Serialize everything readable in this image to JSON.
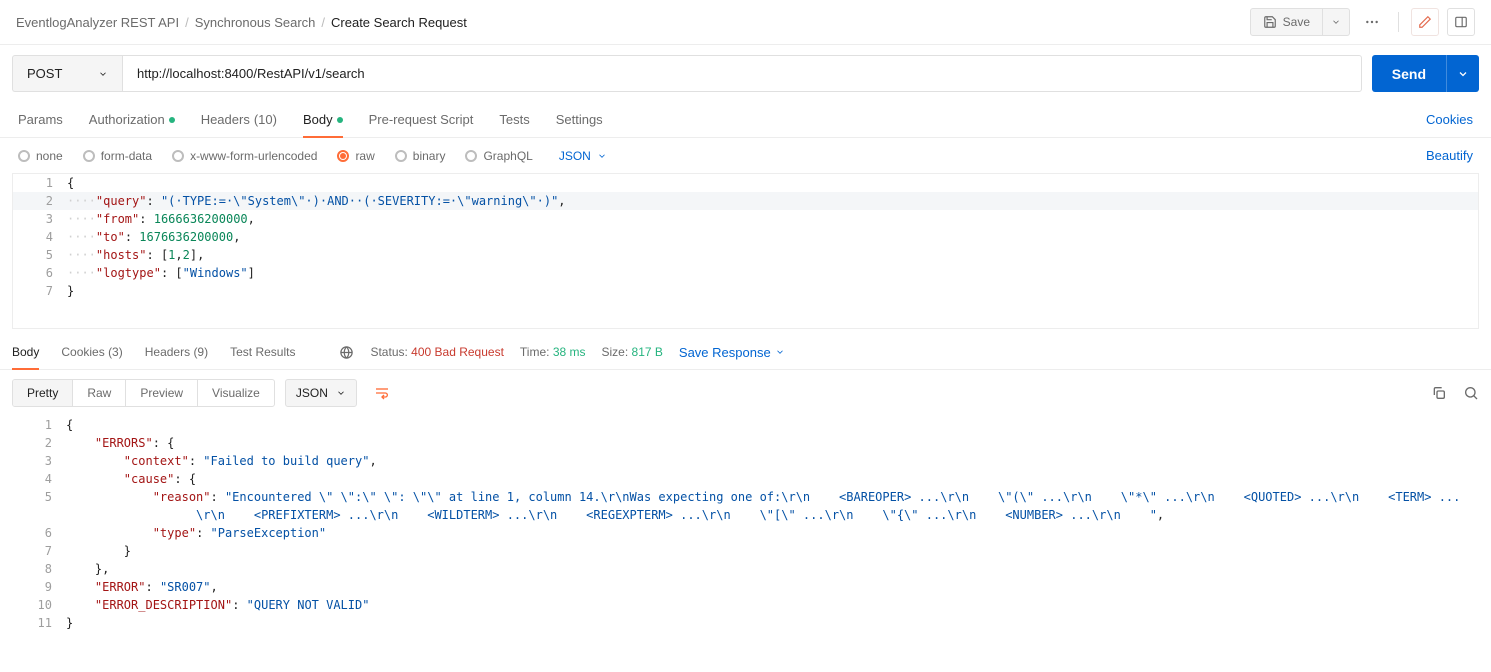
{
  "breadcrumb": {
    "root": "EventlogAnalyzer REST API",
    "mid": "Synchronous Search",
    "current": "Create Search Request"
  },
  "header": {
    "save": "Save"
  },
  "request": {
    "method": "POST",
    "url": "http://localhost:8400/RestAPI/v1/search",
    "send": "Send"
  },
  "req_tabs": {
    "params": "Params",
    "auth": "Authorization",
    "headers": "Headers",
    "headers_count": "(10)",
    "body": "Body",
    "prereq": "Pre-request Script",
    "tests": "Tests",
    "settings": "Settings",
    "cookies_link": "Cookies"
  },
  "body_opts": {
    "none": "none",
    "formdata": "form-data",
    "urlencoded": "x-www-form-urlencoded",
    "raw": "raw",
    "binary": "binary",
    "graphql": "GraphQL",
    "json": "JSON",
    "beautify": "Beautify"
  },
  "req_body": {
    "l1": "{",
    "l2_ws": "····",
    "l2_key": "\"query\"",
    "l2_sep": ": ",
    "l2_str": "\"(·TYPE:=·\\\"System\\\"·)·AND··(·SEVERITY:=·\\\"warning\\\"·)\"",
    "l2_end": ",",
    "l3_ws": "····",
    "l3_key": "\"from\"",
    "l3_sep": ": ",
    "l3_num": "1666636200000",
    "l3_end": ",",
    "l4_ws": "····",
    "l4_key": "\"to\"",
    "l4_sep": ": ",
    "l4_num": "1676636200000",
    "l4_end": ",",
    "l5_ws": "····",
    "l5_key": "\"hosts\"",
    "l5_sep": ": ",
    "l5_pun": "[",
    "l5_n1": "1",
    "l5_c": ",",
    "l5_n2": "2",
    "l5_pun2": "]",
    "l5_end": ",",
    "l6_ws": "····",
    "l6_key": "\"logtype\"",
    "l6_sep": ": ",
    "l6_pun": "[",
    "l6_str": "\"Windows\"",
    "l6_pun2": "]",
    "l7": "}"
  },
  "resp_tabs": {
    "body": "Body",
    "cookies": "Cookies",
    "cookies_count": "(3)",
    "headers": "Headers",
    "headers_count": "(9)",
    "tests": "Test Results"
  },
  "resp_meta": {
    "status_lbl": "Status:",
    "status_val": "400 Bad Request",
    "time_lbl": "Time:",
    "time_val": "38 ms",
    "size_lbl": "Size:",
    "size_val": "817 B",
    "save": "Save Response"
  },
  "resp_toolbar": {
    "pretty": "Pretty",
    "raw": "Raw",
    "preview": "Preview",
    "visualize": "Visualize",
    "json": "JSON"
  },
  "resp_body": {
    "l1": "{",
    "l2_ws": "    ",
    "l2_key": "\"ERRORS\"",
    "l2_sep": ": ",
    "l2_pun": "{",
    "l3_ws": "        ",
    "l3_key": "\"context\"",
    "l3_sep": ": ",
    "l3_str": "\"Failed to build query\"",
    "l3_end": ",",
    "l4_ws": "        ",
    "l4_key": "\"cause\"",
    "l4_sep": ": ",
    "l4_pun": "{",
    "l5_ws": "            ",
    "l5_key": "\"reason\"",
    "l5_sep": ": ",
    "l5_str": "\"Encountered \\\" \\\":\\\" \\\": \\\"\\\" at line 1, column 14.\\r\\nWas expecting one of:\\r\\n    <BAREOPER> ...\\r\\n    \\\"(\\\" ...\\r\\n    \\\"*\\\" ...\\r\\n    <QUOTED> ...\\r\\n    <TERM> ...",
    "l5b_ws": "                  ",
    "l5b_str": "\\r\\n    <PREFIXTERM> ...\\r\\n    <WILDTERM> ...\\r\\n    <REGEXPTERM> ...\\r\\n    \\\"[\\\" ...\\r\\n    \\\"{\\\" ...\\r\\n    <NUMBER> ...\\r\\n    \"",
    "l5b_end": ",",
    "l6_ws": "            ",
    "l6_key": "\"type\"",
    "l6_sep": ": ",
    "l6_str": "\"ParseException\"",
    "l7_ws": "        ",
    "l7_pun": "}",
    "l8_ws": "    ",
    "l8_pun": "}",
    "l8_end": ",",
    "l9_ws": "    ",
    "l9_key": "\"ERROR\"",
    "l9_sep": ": ",
    "l9_str": "\"SR007\"",
    "l9_end": ",",
    "l10_ws": "    ",
    "l10_key": "\"ERROR_DESCRIPTION\"",
    "l10_sep": ": ",
    "l10_str": "\"QUERY NOT VALID\"",
    "l11": "}"
  }
}
